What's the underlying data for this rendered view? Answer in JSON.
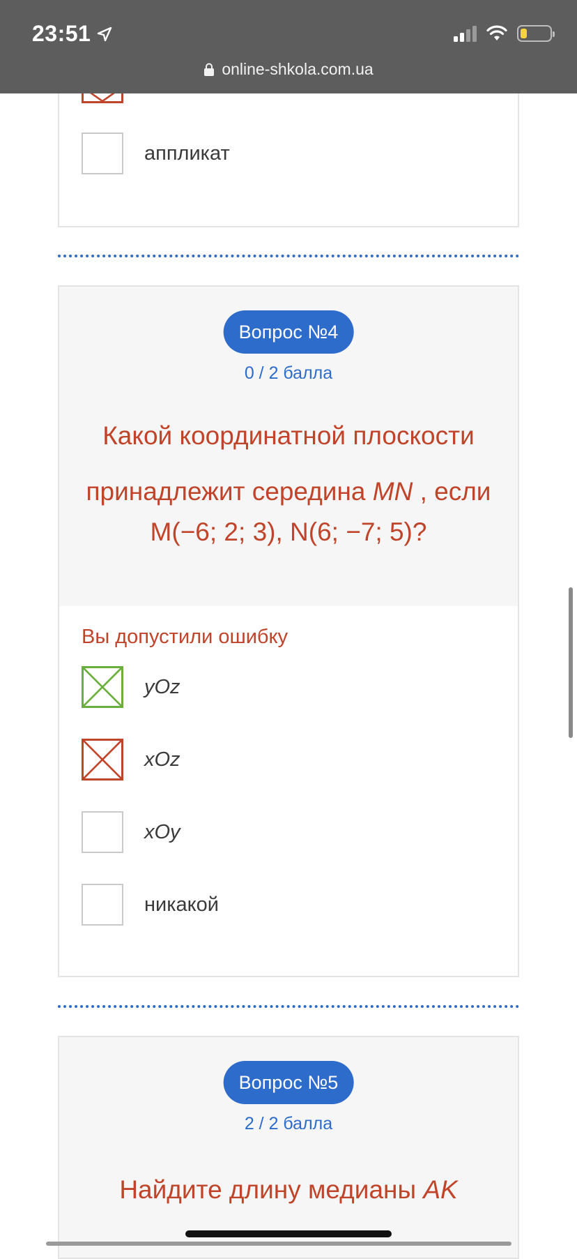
{
  "status_bar": {
    "time": "23:51",
    "url": "online-shkola.com.ua"
  },
  "question3": {
    "options": [
      {
        "label": "аппликат",
        "state": "unchecked"
      }
    ]
  },
  "question4": {
    "badge": "Вопрос №4",
    "score": "0 / 2 балла",
    "text_line1": "Какой координатной плоскости",
    "text_line2_prefix": "принадлежит середина ",
    "text_line2_math": "MN",
    "text_line2_suffix": " , если",
    "text_line3": "M(−6; 2; 3), N(6; −7; 5)?",
    "feedback": "Вы допустили ошибку",
    "options": [
      {
        "label": "yOz",
        "state": "correct"
      },
      {
        "label": "xOz",
        "state": "wrong"
      },
      {
        "label": "xOy",
        "state": "unchecked"
      },
      {
        "label": "никакой",
        "state": "unchecked"
      }
    ]
  },
  "question5": {
    "badge": "Вопрос №5",
    "score": "2 / 2 балла",
    "text_prefix": "Найдите длину медианы ",
    "text_math": "AK"
  },
  "colors": {
    "accent_blue": "#2d6ccb",
    "error_red": "#c0442a",
    "correct_green": "#6aaf3d"
  }
}
